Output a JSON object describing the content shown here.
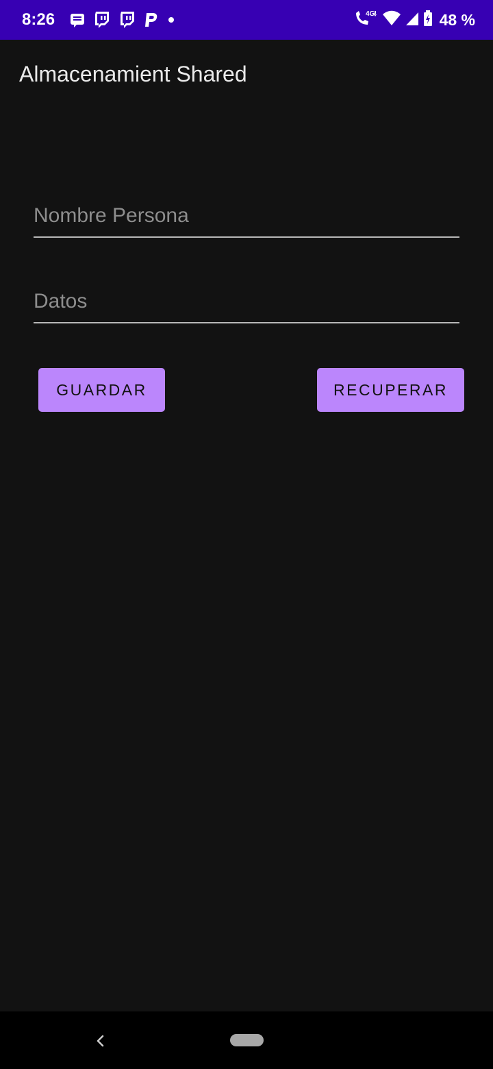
{
  "status_bar": {
    "time": "8:26",
    "notification_icons": [
      "message-icon",
      "twitch-icon",
      "twitch-icon",
      "paypal-icon",
      "dot-icon"
    ],
    "network_label": "4G",
    "battery_percent": "48 %",
    "background_color": "#3700b3"
  },
  "app_bar": {
    "title": "Almacenamient Shared"
  },
  "form": {
    "nombre_placeholder": "Nombre Persona",
    "nombre_value": "",
    "datos_placeholder": "Datos",
    "datos_value": ""
  },
  "buttons": {
    "guardar_label": "GUARDAR",
    "recuperar_label": "RECUPERAR",
    "accent_color": "#bb86fc"
  },
  "nav_bar": {
    "icons": [
      "back-icon",
      "home-pill-icon"
    ]
  }
}
